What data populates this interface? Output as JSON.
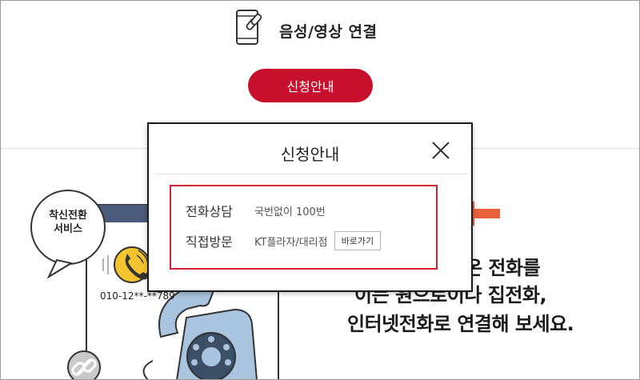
{
  "header": {
    "title": "음성/영상 연결",
    "icon": "phone-link-icon",
    "apply_button": "신청안내"
  },
  "illustration": {
    "bubble_line1": "착신전환",
    "bubble_line2": "서비스",
    "number": "010-12**-**789",
    "icons": [
      "speech-bubble-icon",
      "ringing-phone-icon",
      "link-icon",
      "rotary-phone-icon"
    ]
  },
  "background_text": {
    "line1": "온 전화를",
    "line2": "이는 원으로이나 집전화,",
    "line3": "인터넷전화로 연결해 보세요."
  },
  "modal": {
    "title": "신청안내",
    "close_icon": "close-icon",
    "rows": [
      {
        "label": "전화상담",
        "value": "국번없이 100번"
      },
      {
        "label": "직접방문",
        "value": "KT플라자/대리점",
        "button": "바로가기"
      }
    ]
  },
  "colors": {
    "brand_red": "#c8102e",
    "highlight_red": "#d0232f",
    "arrow_orange": "#e8603c"
  }
}
